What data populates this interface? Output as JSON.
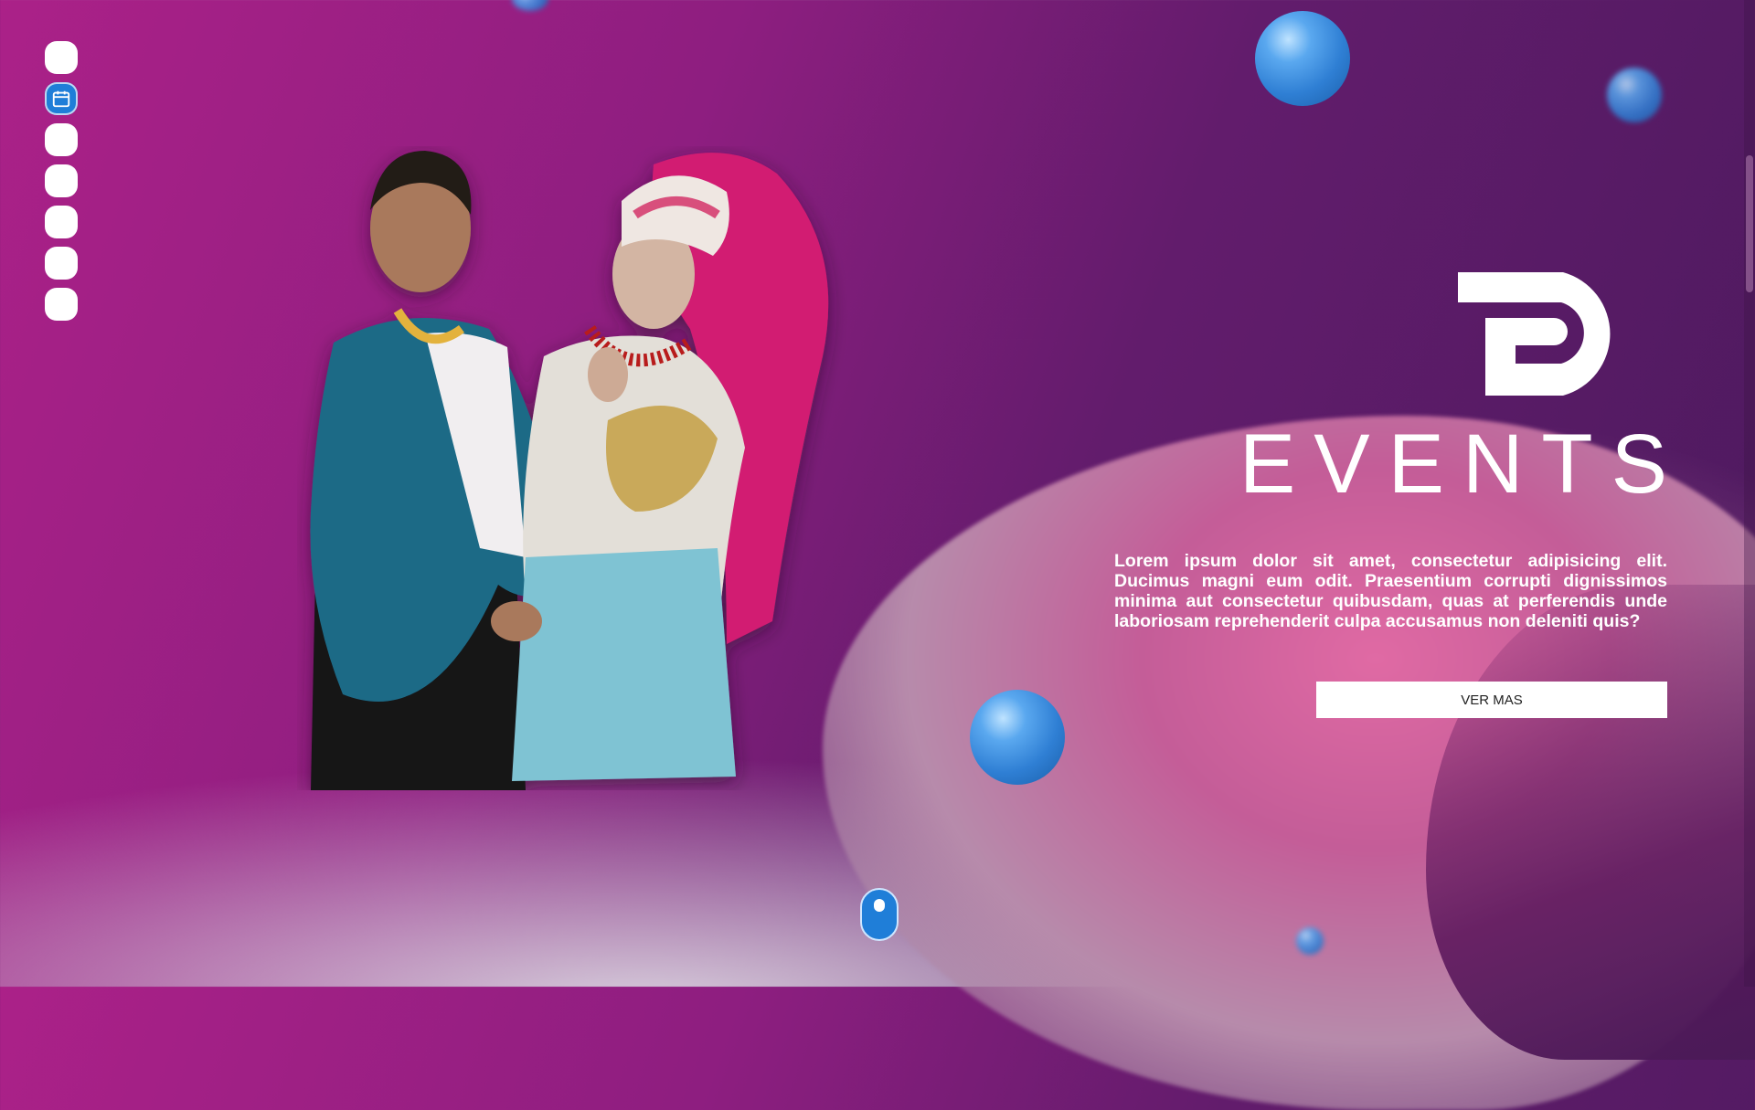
{
  "side_nav": {
    "items": [
      {
        "icon": "circle-dot",
        "active": false
      },
      {
        "icon": "calendar-icon",
        "active": true
      },
      {
        "icon": "circle-dot",
        "active": false
      },
      {
        "icon": "circle-dot",
        "active": false
      },
      {
        "icon": "circle-dot",
        "active": false
      },
      {
        "icon": "circle-dot",
        "active": false
      },
      {
        "icon": "circle-dot",
        "active": false
      }
    ]
  },
  "hero": {
    "brand": "EVENTS",
    "description": "Lorem ipsum dolor sit amet, consectetur adipisicing elit. Ducimus magni eum odit. Praesentium corrupti dignissimos minima aut consectetur quibusdam, quas at perferendis unde laboriosam reprehenderit culpa accusamus non deleniti quis?",
    "cta_label": "VER MAS"
  },
  "colors": {
    "accent": "#1f7ed8",
    "background_start": "#ab2188",
    "background_end": "#4c1a5e"
  }
}
